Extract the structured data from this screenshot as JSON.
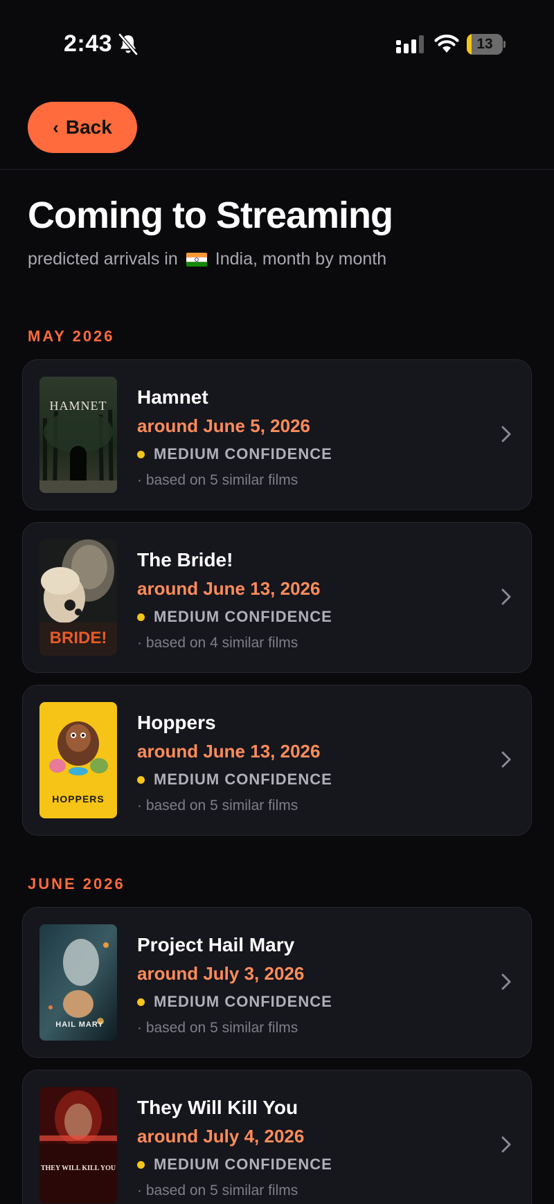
{
  "status_bar": {
    "time": "2:43",
    "battery_level": "13",
    "battery_fraction": 0.13,
    "icons": [
      "bell-slash-icon",
      "signal-icon",
      "wifi-icon",
      "battery-icon"
    ]
  },
  "nav": {
    "back_label": "Back"
  },
  "header": {
    "title": "Coming to Streaming",
    "subtitle_before": "predicted arrivals in",
    "country": "India, month by month"
  },
  "colors": {
    "accent": "#ff6b3d",
    "date": "#ff8c5a",
    "confidence_dot": "#f5c518",
    "background": "#0a0a0d",
    "card": "#16161d"
  },
  "sections": [
    {
      "month": "MAY 2026",
      "films": [
        {
          "title": "Hamnet",
          "arrival": "around June 5, 2026",
          "confidence": "MEDIUM CONFIDENCE",
          "basis": "· based on 5 similar films",
          "poster_text": "HAMNET"
        },
        {
          "title": "The Bride!",
          "arrival": "around June 13, 2026",
          "confidence": "MEDIUM CONFIDENCE",
          "basis": "· based on 4 similar films",
          "poster_text": "BRIDE!"
        },
        {
          "title": "Hoppers",
          "arrival": "around June 13, 2026",
          "confidence": "MEDIUM CONFIDENCE",
          "basis": "· based on 5 similar films",
          "poster_text": "HOPPERS"
        }
      ]
    },
    {
      "month": "JUNE 2026",
      "films": [
        {
          "title": "Project Hail Mary",
          "arrival": "around July 3, 2026",
          "confidence": "MEDIUM CONFIDENCE",
          "basis": "· based on 5 similar films",
          "poster_text": "HAIL MARY"
        },
        {
          "title": "They Will Kill You",
          "arrival": "around July 4, 2026",
          "confidence": "MEDIUM CONFIDENCE",
          "basis": "· based on 5 similar films",
          "poster_text": "THEY WILL KILL YOU"
        }
      ]
    }
  ]
}
